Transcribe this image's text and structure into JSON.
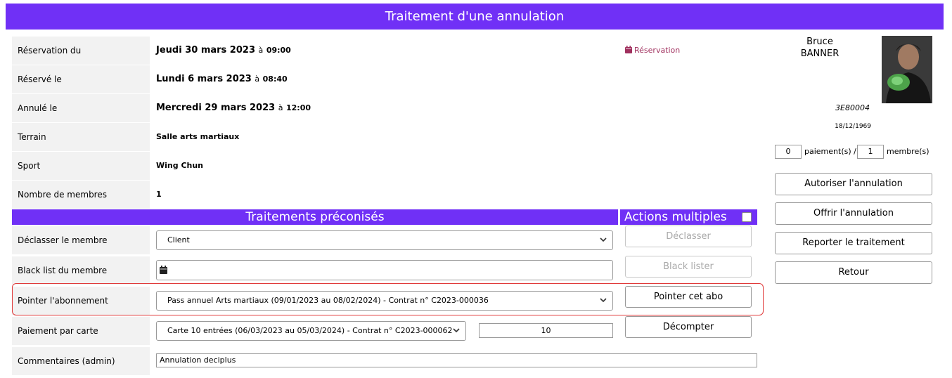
{
  "title": "Traitement d'une annulation",
  "info_rows": [
    {
      "label": "Réservation du",
      "value": "Jeudi 30 mars 2023",
      "at": "à",
      "time": "09:00"
    },
    {
      "label": "Réservé le",
      "value": "Lundi 6 mars 2023",
      "at": "à",
      "time": "08:40"
    },
    {
      "label": "Annulé le",
      "value": "Mercredi 29 mars 2023",
      "at": "à",
      "time": "12:00"
    },
    {
      "label": "Terrain",
      "value": "Salle arts martiaux"
    },
    {
      "label": "Sport",
      "value": "Wing Chun"
    },
    {
      "label": "Nombre de membres",
      "value": "1"
    }
  ],
  "reservation_link": "Réservation",
  "member": {
    "first_name": "Bruce",
    "last_name": "BANNER",
    "code": "3E80004",
    "birth_date": "18/12/1969",
    "payments_value": "0",
    "payments_label": "paiement(s) /",
    "members_value": "1",
    "members_label": "membre(s)"
  },
  "right_buttons": [
    "Autoriser l'annulation",
    "Offrir l'annulation",
    "Reporter le traitement",
    "Retour"
  ],
  "sections": {
    "treatments": "Traitements préconisés",
    "actions": "Actions multiples"
  },
  "treatment_rows": {
    "declasser": {
      "label": "Déclasser le membre",
      "select": "Client",
      "button": "Déclasser"
    },
    "blacklist": {
      "label": "Black list du membre",
      "input": "",
      "button": "Black lister"
    },
    "pointer": {
      "label": "Pointer l'abonnement",
      "select": "Pass annuel Arts martiaux (09/01/2023 au 08/02/2024) - Contrat n° C2023-000036",
      "button": "Pointer cet abo"
    },
    "paiement": {
      "label": "Paiement par carte",
      "select": "Carte 10 entrées (06/03/2023 au 05/03/2024) - Contrat n° C2023-000062",
      "quantity": "10",
      "button": "Décompter"
    },
    "comments": {
      "label": "Commentaires (admin)",
      "value": "Annulation deciplus"
    }
  },
  "colors": {
    "header": "#7030f6",
    "link": "#a0305e",
    "highlight": "#e03a3a"
  }
}
